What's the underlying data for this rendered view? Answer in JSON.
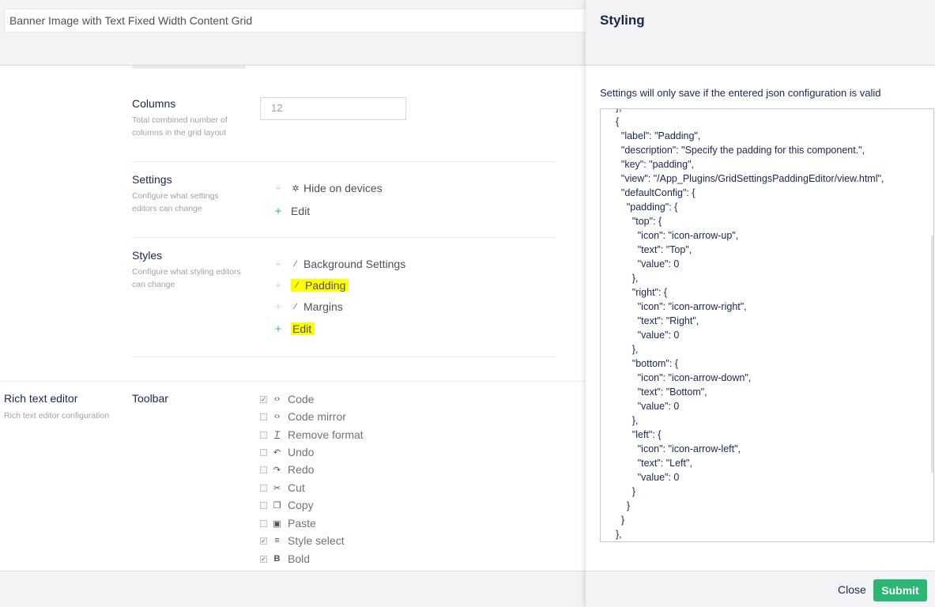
{
  "editor": {
    "title_value": "Banner Image with Text Fixed Width  Content Grid",
    "columns": {
      "title": "Columns",
      "description": "Total combined number of columns in the grid layout",
      "value": "12"
    },
    "settings": {
      "title": "Settings",
      "description": "Configure what settings editors can change",
      "items": [
        {
          "label": "Hide on devices",
          "icon": "gear-icon"
        }
      ],
      "edit_label": "Edit"
    },
    "styles": {
      "title": "Styles",
      "description": "Configure what styling editors can change",
      "items": [
        {
          "label": "Background Settings",
          "icon": "brush-icon",
          "highlighted": false
        },
        {
          "label": "Padding",
          "icon": "brush-icon",
          "highlighted": true
        },
        {
          "label": "Margins",
          "icon": "brush-icon",
          "highlighted": false
        }
      ],
      "edit_label": "Edit"
    },
    "rte": {
      "title": "Rich text editor",
      "description": "Rich text editor configuration",
      "toolbar_title": "Toolbar",
      "toolbar_items": [
        {
          "label": "Code",
          "icon": "code-icon",
          "checked": true
        },
        {
          "label": "Code mirror",
          "icon": "code-icon",
          "checked": false
        },
        {
          "label": "Remove format",
          "icon": "remove-format-icon",
          "checked": false
        },
        {
          "label": "Undo",
          "icon": "undo-icon",
          "checked": false
        },
        {
          "label": "Redo",
          "icon": "redo-icon",
          "checked": false
        },
        {
          "label": "Cut",
          "icon": "scissors-icon",
          "checked": false
        },
        {
          "label": "Copy",
          "icon": "copy-icon",
          "checked": false
        },
        {
          "label": "Paste",
          "icon": "paste-icon",
          "checked": false
        },
        {
          "label": "Style select",
          "icon": "style-select-icon",
          "checked": true
        },
        {
          "label": "Bold",
          "icon": "bold-icon",
          "checked": true
        }
      ]
    },
    "highlight_color": "#ffff00"
  },
  "panel": {
    "title": "Styling",
    "description": "Settings will only save if the entered json configuration is valid",
    "json_text": "  },\n  {\n    \"label\": \"Padding\",\n    \"description\": \"Specify the padding for this component.\",\n    \"key\": \"padding\",\n    \"view\": \"/App_Plugins/GridSettingsPaddingEditor/view.html\",\n    \"defaultConfig\": {\n      \"padding\": {\n        \"top\": {\n          \"icon\": \"icon-arrow-up\",\n          \"text\": \"Top\",\n          \"value\": 0\n        },\n        \"right\": {\n          \"icon\": \"icon-arrow-right\",\n          \"text\": \"Right\",\n          \"value\": 0\n        },\n        \"bottom\": {\n          \"icon\": \"icon-arrow-down\",\n          \"text\": \"Bottom\",\n          \"value\": 0\n        },\n        \"left\": {\n          \"icon\": \"icon-arrow-left\",\n          \"text\": \"Left\",\n          \"value\": 0\n        }\n      }\n    }\n  },",
    "close_label": "Close",
    "submit_label": "Submit",
    "submit_color": "#2bb673"
  }
}
